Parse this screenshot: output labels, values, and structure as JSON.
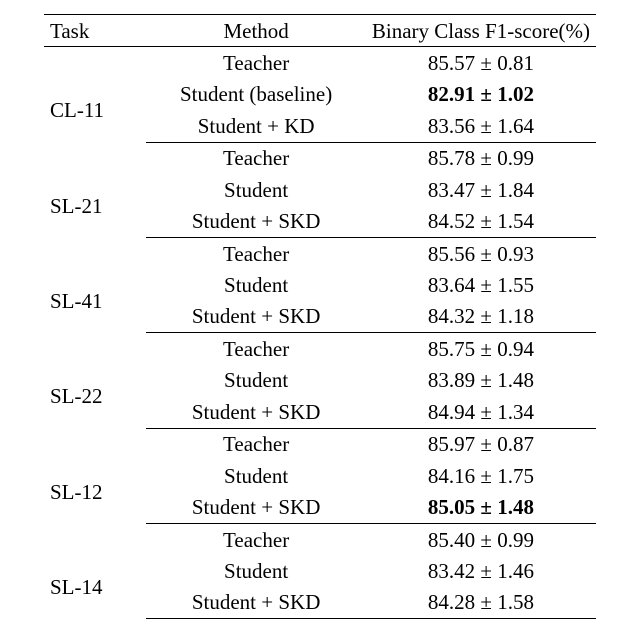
{
  "chart_data": {
    "type": "table",
    "title": "",
    "columns": [
      "Task",
      "Method",
      "Binary Class F1-score(%)"
    ],
    "groups": [
      {
        "task": "CL-11",
        "rows": [
          {
            "method": "Teacher",
            "score": "85.57 ± 0.81",
            "bold": false
          },
          {
            "method": "Student (baseline)",
            "score": "82.91 ± 1.02",
            "bold": true
          },
          {
            "method": "Student + KD",
            "score": "83.56 ± 1.64",
            "bold": false
          }
        ]
      },
      {
        "task": "SL-21",
        "rows": [
          {
            "method": "Teacher",
            "score": "85.78 ± 0.99",
            "bold": false
          },
          {
            "method": "Student",
            "score": "83.47 ± 1.84",
            "bold": false
          },
          {
            "method": "Student + SKD",
            "score": "84.52 ± 1.54",
            "bold": false
          }
        ]
      },
      {
        "task": "SL-41",
        "rows": [
          {
            "method": "Teacher",
            "score": "85.56 ± 0.93",
            "bold": false
          },
          {
            "method": "Student",
            "score": "83.64 ± 1.55",
            "bold": false
          },
          {
            "method": "Student + SKD",
            "score": "84.32 ± 1.18",
            "bold": false
          }
        ]
      },
      {
        "task": "SL-22",
        "rows": [
          {
            "method": "Teacher",
            "score": "85.75 ± 0.94",
            "bold": false
          },
          {
            "method": "Student",
            "score": "83.89 ± 1.48",
            "bold": false
          },
          {
            "method": "Student + SKD",
            "score": "84.94 ± 1.34",
            "bold": false
          }
        ]
      },
      {
        "task": "SL-12",
        "rows": [
          {
            "method": "Teacher",
            "score": "85.97 ± 0.87",
            "bold": false
          },
          {
            "method": "Student",
            "score": "84.16 ± 1.75",
            "bold": false
          },
          {
            "method": "Student + SKD",
            "score": "85.05 ± 1.48",
            "bold": true
          }
        ]
      },
      {
        "task": "SL-14",
        "rows": [
          {
            "method": "Teacher",
            "score": "85.40 ± 0.99",
            "bold": false
          },
          {
            "method": "Student",
            "score": "83.42 ± 1.46",
            "bold": false
          },
          {
            "method": "Student + SKD",
            "score": "84.28 ± 1.58",
            "bold": false
          }
        ]
      }
    ]
  }
}
